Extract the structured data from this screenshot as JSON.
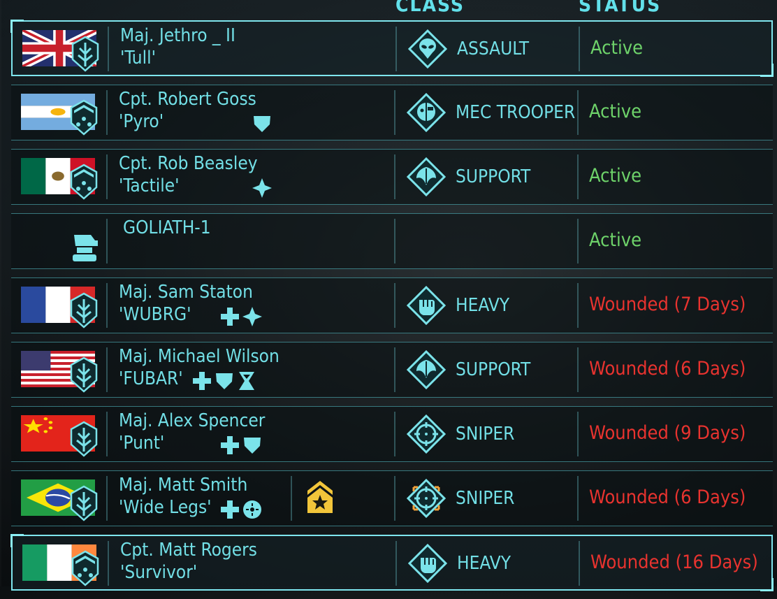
{
  "headers": {
    "class": "CLASS",
    "status": "STATUS"
  },
  "colors": {
    "accent": "#72dfe6",
    "active": "#6ed36a",
    "wounded": "#e8332f"
  },
  "soldiers": [
    {
      "name": "Maj. Jethro _ II",
      "nick": "'Tull'",
      "flag": "uk",
      "badge": "major",
      "perks": [],
      "class": "ASSAULT",
      "class_icon": "alien-skull-icon",
      "status": "Active",
      "status_type": "active",
      "selected": true
    },
    {
      "name": "Cpt. Robert Goss",
      "nick": "'Pyro'",
      "flag": "argentina",
      "badge": "captain",
      "perks": [
        "shield-icon"
      ],
      "class": "MEC TROOPER",
      "class_icon": "mec-head-icon",
      "status": "Active",
      "status_type": "active"
    },
    {
      "name": "Cpt. Rob Beasley",
      "nick": "'Tactile'",
      "flag": "mexico",
      "badge": "captain",
      "perks": [
        "cross-plus-icon"
      ],
      "class": "SUPPORT",
      "class_icon": "wings-icon",
      "status": "Active",
      "status_type": "active"
    },
    {
      "name": "GOLIATH-1",
      "nick": "",
      "flag": "",
      "badge": "shiv",
      "perks": [],
      "class": "",
      "class_icon": "",
      "status": "Active",
      "status_type": "active"
    },
    {
      "name": "Maj. Sam Staton",
      "nick": "'WUBRG'",
      "flag": "france",
      "badge": "major",
      "perks": [
        "medkit-plus-icon",
        "cross-plus-icon"
      ],
      "class": "HEAVY",
      "class_icon": "fist-icon",
      "status": "Wounded (7 Days)",
      "status_type": "wounded"
    },
    {
      "name": "Maj. Michael Wilson",
      "nick": "'FUBAR'",
      "flag": "usa",
      "badge": "major",
      "perks": [
        "medkit-plus-icon",
        "shield-icon",
        "hourglass-icon"
      ],
      "class": "SUPPORT",
      "class_icon": "wings-icon",
      "status": "Wounded (6 Days)",
      "status_type": "wounded"
    },
    {
      "name": "Maj. Alex Spencer",
      "nick": "'Punt'",
      "flag": "china",
      "badge": "major",
      "perks": [
        "medkit-plus-icon",
        "shield-icon"
      ],
      "class": "SNIPER",
      "class_icon": "crosshair-icon",
      "status": "Wounded (9 Days)",
      "status_type": "wounded"
    },
    {
      "name": "Maj. Matt Smith",
      "nick": "'Wide Legs'",
      "flag": "brazil",
      "badge": "major",
      "perks": [
        "medkit-plus-icon",
        "target-circle-icon"
      ],
      "class": "SNIPER",
      "class_icon": "crosshair-orange-icon",
      "status": "Wounded (6 Days)",
      "status_type": "wounded",
      "rank_icon": "gold-chevron-star-icon"
    },
    {
      "name": "Cpt. Matt Rogers",
      "nick": "'Survivor'",
      "flag": "ireland",
      "badge": "captain",
      "perks": [],
      "class": "HEAVY",
      "class_icon": "fist-icon",
      "status": "Wounded (16 Days)",
      "status_type": "wounded",
      "selected": true
    }
  ]
}
